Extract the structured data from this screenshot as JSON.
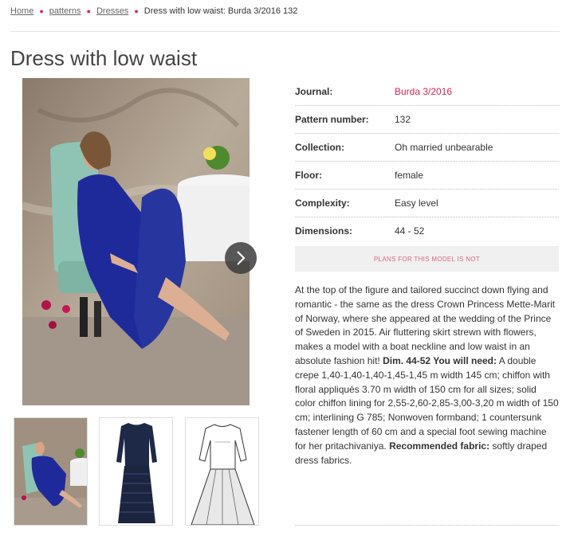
{
  "breadcrumb": {
    "home": "Home",
    "patterns": "patterns",
    "dresses": "Dresses",
    "current": "Dress with low waist: Burda 3/2016 132"
  },
  "title": "Dress with low waist",
  "specs": [
    {
      "key": "Journal:",
      "value": "Burda 3/2016"
    },
    {
      "key": "Pattern number:",
      "value": "132"
    },
    {
      "key": "Collection:",
      "value": "Oh married unbearable"
    },
    {
      "key": "Floor:",
      "value": "female"
    },
    {
      "key": "Complexity:",
      "value": "Easy level"
    },
    {
      "key": "Dimensions:",
      "value": "44 - 52"
    }
  ],
  "plans_notice": "PLANS FOR THIS MODEL IS NOT",
  "description": {
    "p1": "At the top of the figure and tailored succinct down flying and romantic - the same as the dress Crown Princess Mette-Marit of Norway, where she appeared at the wedding of the Prince of Sweden in 2015. Air fluttering skirt strewn with flowers, makes a model with a boat neckline and low waist in an absolute fashion hit! ",
    "dim_label": "Dim. 44-52",
    "need_label": " You will need:",
    "need_text": " A double crepe 1,40-1,40-1,40-1,45-1,45 m width 145 cm; chiffon with floral appliqués 3.70 m width of 150 cm for all sizes; solid color chiffon lining for 2,55-2,60-2,85-3,00-3,20 m width of 150 cm; interlining G 785; Nonwoven formband; 1 countersunk fastener length of 60 cm and a special foot sewing machine for her pritachivaniya. ",
    "rec_label": "Recommended fabric:",
    "rec_text": " softly draped dress fabrics."
  },
  "colors": {
    "accent": "#d8264f",
    "dress": "#1f2a9a",
    "chair": "#8fc4b4"
  },
  "icons": {
    "next": "chevron-right-icon"
  }
}
